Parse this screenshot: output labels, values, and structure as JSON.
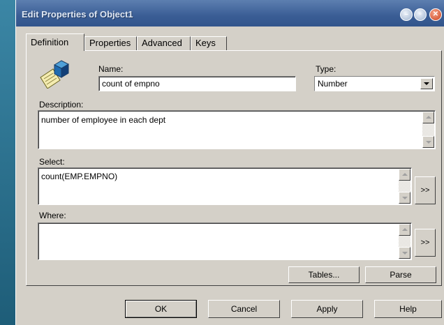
{
  "window": {
    "title": "Edit Properties of Object1"
  },
  "title_buttons": {
    "minimize": "–",
    "maximize": "▫",
    "close": "✕"
  },
  "tabs": [
    {
      "label": "Definition",
      "active": true
    },
    {
      "label": "Properties",
      "active": false
    },
    {
      "label": "Advanced",
      "active": false
    },
    {
      "label": "Keys",
      "active": false
    }
  ],
  "icons": {
    "object_icon": "object-definition-icon"
  },
  "form": {
    "name_label": "Name:",
    "name_value": "count of empno",
    "type_label": "Type:",
    "type_value": "Number",
    "description_label": "Description:",
    "description_value": "number of employee in each dept",
    "select_label": "Select:",
    "select_value": "count(EMP.EMPNO)",
    "select_more": ">>",
    "where_label": "Where:",
    "where_value": "",
    "where_more": ">>"
  },
  "panel_buttons": {
    "tables": "Tables...",
    "parse": "Parse"
  },
  "dialog_buttons": {
    "ok": "OK",
    "cancel": "Cancel",
    "apply": "Apply",
    "help": "Help"
  }
}
